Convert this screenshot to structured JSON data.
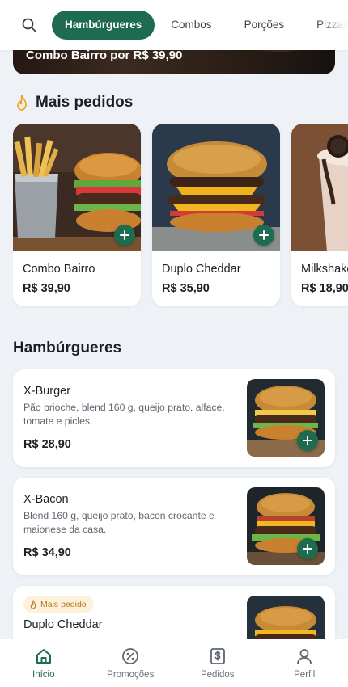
{
  "colors": {
    "primary": "#1f6b4f",
    "background": "#eef1f6",
    "badge_bg": "#fdf1dc",
    "badge_text": "#b7791f",
    "flame": "#f2a31b"
  },
  "search": {
    "icon": "search-icon"
  },
  "categories": [
    {
      "label": "Hambúrgueres",
      "active": true
    },
    {
      "label": "Combos",
      "active": false
    },
    {
      "label": "Porções",
      "active": false
    },
    {
      "label": "Pizzas",
      "active": false
    }
  ],
  "hero": {
    "text": "Combo Bairro por R$ 39,90"
  },
  "popular": {
    "title": "Mais pedidos",
    "icon": "flame-icon",
    "items": [
      {
        "name": "Combo Bairro",
        "price": "R$ 39,90"
      },
      {
        "name": "Duplo Cheddar",
        "price": "R$ 35,90"
      },
      {
        "name": "Milkshake",
        "price": "R$ 18,90"
      }
    ]
  },
  "burgers": {
    "title": "Hambúrgueres",
    "items": [
      {
        "name": "X-Burger",
        "description": "Pão brioche, blend 160 g, queijo prato, alface, tomate e picles.",
        "price": "R$ 28,90"
      },
      {
        "name": "X-Bacon",
        "description": "Blend 160 g, queijo prato, bacon crocante e maionese da casa.",
        "price": "R$ 34,90"
      },
      {
        "badge": "Mais pedido",
        "name": "Duplo Cheddar"
      }
    ]
  },
  "nav": [
    {
      "label": "Início",
      "icon": "home-icon",
      "active": true
    },
    {
      "label": "Promoções",
      "icon": "discount-icon",
      "active": false
    },
    {
      "label": "Pedidos",
      "icon": "receipt-icon",
      "active": false
    },
    {
      "label": "Perfil",
      "icon": "user-icon",
      "active": false
    }
  ]
}
